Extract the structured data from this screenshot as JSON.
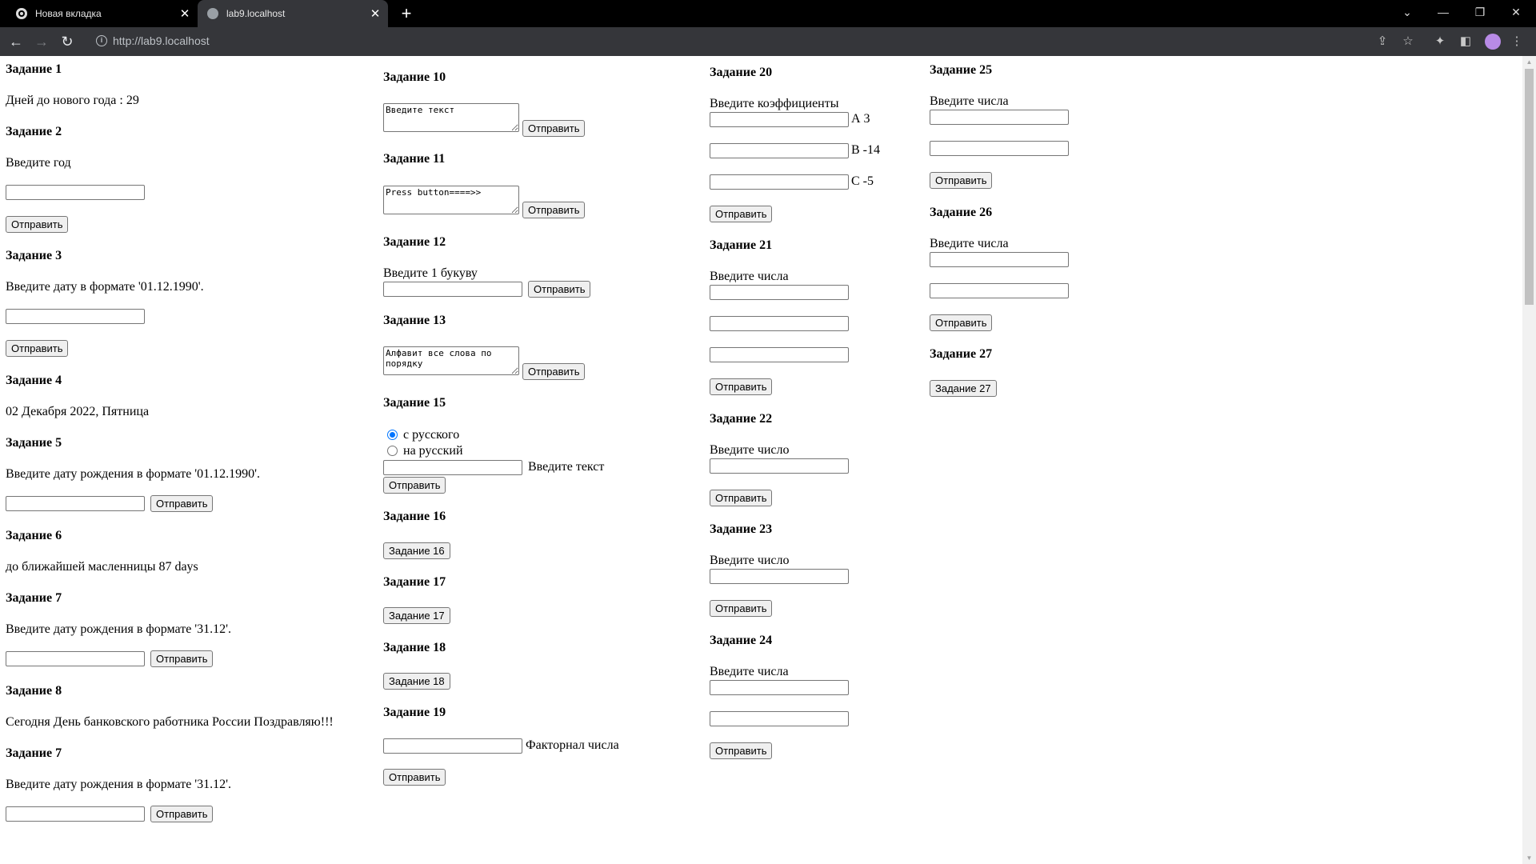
{
  "browser": {
    "tabs": [
      {
        "label": "Новая вкладка",
        "active": false
      },
      {
        "label": "lab9.localhost",
        "active": true
      }
    ],
    "url": "http://lab9.localhost",
    "icons": [
      "back-icon",
      "forward-icon",
      "reload-icon",
      "info-icon",
      "share-icon",
      "star-icon",
      "extensions-icon",
      "sidepanel-icon",
      "avatar",
      "menu-icon"
    ]
  },
  "col1": {
    "z1": {
      "title": "Задание 1",
      "text": "Дней до нового года : 29"
    },
    "z2": {
      "title": "Задание 2",
      "label": "Введите год",
      "button": "Отправить"
    },
    "z3": {
      "title": "Задание 3",
      "label": "Введите дату в формате '01.12.1990'.",
      "button": "Отправить"
    },
    "z4": {
      "title": "Задание 4",
      "text": "02 Декабря 2022, Пятница"
    },
    "z5": {
      "title": "Задание 5",
      "label": "Введите дату рождения в формате '01.12.1990'.",
      "button": "Отправить"
    },
    "z6": {
      "title": "Задание 6",
      "text": "до ближайшей масленницы 87 days"
    },
    "z7": {
      "title": "Задание 7",
      "label": "Введите дату рождения в формате '31.12'.",
      "button": "Отправить"
    },
    "z8": {
      "title": "Задание 8",
      "text": "Сегодня День банковского работника России Поздравляю!!!"
    },
    "z7b": {
      "title": "Задание 7",
      "label": "Введите дату рождения в формате '31.12'.",
      "button": "Отправить"
    }
  },
  "col2": {
    "z10": {
      "title": "Задание 10",
      "textarea": "Введите текст",
      "button": "Отправить"
    },
    "z11": {
      "title": "Задание 11",
      "textarea": "Press button====>>",
      "button": "Отправить"
    },
    "z12": {
      "title": "Задание 12",
      "label": "Введите 1 букуву",
      "button": "Отправить"
    },
    "z13": {
      "title": "Задание 13",
      "textarea": "Алфавит все слова по порядку",
      "button": "Отправить"
    },
    "z15": {
      "title": "Задание 15",
      "radio1": "с русского",
      "radio2": "на русский",
      "selected": "с русского",
      "label": "Введите текст",
      "button": "Отправить"
    },
    "z16": {
      "title": "Задание 16",
      "button": "Задание 16"
    },
    "z17": {
      "title": "Задание 17",
      "button": "Задание 17"
    },
    "z18": {
      "title": "Задание 18",
      "button": "Задание 18"
    },
    "z19": {
      "title": "Задание 19",
      "label": "Факторнал числа",
      "button": "Отправить"
    }
  },
  "col3": {
    "z20": {
      "title": "Задание 20",
      "label": "Введите коэффициенты",
      "a": "А 3",
      "b": "В -14",
      "c": "С -5",
      "button": "Отправить"
    },
    "z21": {
      "title": "Задание 21",
      "label": "Введите числа",
      "button": "Отправить"
    },
    "z22": {
      "title": "Задание 22",
      "label": "Введите число",
      "button": "Отправить"
    },
    "z23": {
      "title": "Задание 23",
      "label": "Введите число",
      "button": "Отправить"
    },
    "z24": {
      "title": "Задание 24",
      "label": "Введите числа",
      "button": "Отправить"
    }
  },
  "col4": {
    "z25": {
      "title": "Задание 25",
      "label": "Введите числа",
      "button": "Отправить"
    },
    "z26": {
      "title": "Задание 26",
      "label": "Введите числа",
      "button": "Отправить"
    },
    "z27": {
      "title": "Задание 27",
      "button": "Задание 27"
    }
  }
}
